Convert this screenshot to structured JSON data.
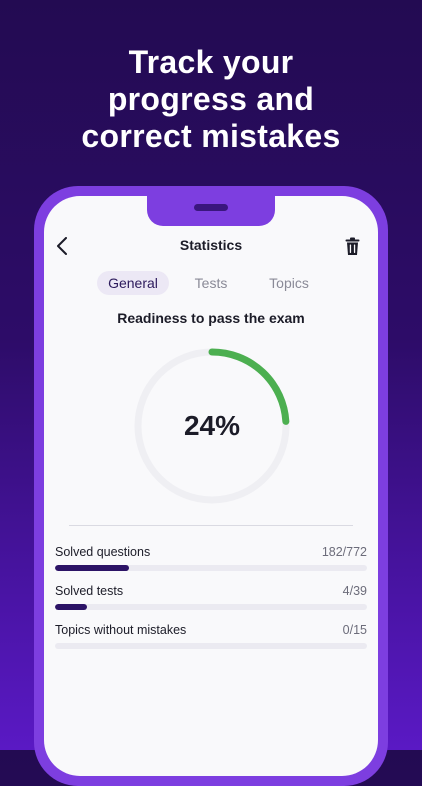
{
  "promo": {
    "headline": [
      "Track your",
      "progress and",
      "correct mistakes"
    ]
  },
  "colors": {
    "background_top": "#230b52",
    "background_bottom": "#5a19c4",
    "phone_frame": "#7d3ee0",
    "progress_ring": "#4caf50",
    "progress_track": "#efeff3",
    "bar_fill": "#2c1366",
    "bar_track": "#ebeaf1",
    "tab_active_bg": "#ece8f5"
  },
  "nav": {
    "title": "Statistics",
    "back_icon": "chevron-left-icon",
    "delete_icon": "trash-icon"
  },
  "tabs": [
    {
      "label": "General",
      "active": true
    },
    {
      "label": "Tests",
      "active": false
    },
    {
      "label": "Topics",
      "active": false
    }
  ],
  "readiness": {
    "title": "Readiness to pass the exam",
    "value_label": "24%",
    "fraction": 0.24
  },
  "stats": [
    {
      "label": "Solved questions",
      "value": "182/772",
      "done": 182,
      "total": 772
    },
    {
      "label": "Solved tests",
      "value": "4/39",
      "done": 4,
      "total": 39
    },
    {
      "label": "Topics without mistakes",
      "value": "0/15",
      "done": 0,
      "total": 15
    }
  ]
}
